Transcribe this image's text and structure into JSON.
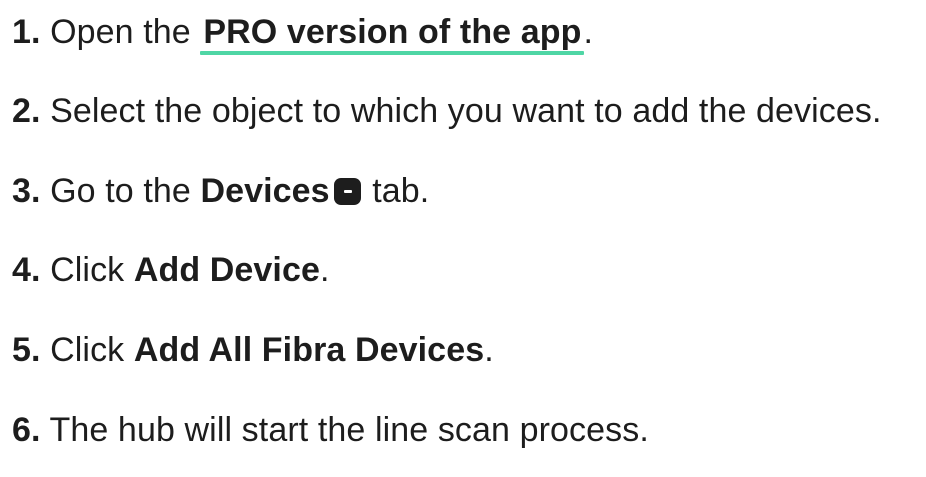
{
  "steps": [
    {
      "number": "1.",
      "before": "Open the",
      "link": "PRO version of the app",
      "after": "."
    },
    {
      "number": "2.",
      "text": "Select the object to which you want to add the devices."
    },
    {
      "number": "3.",
      "before": "Go to the",
      "bold": "Devices",
      "icon": "devices-tab-icon",
      "after": "tab."
    },
    {
      "number": "4.",
      "before": "Click",
      "bold": "Add Device",
      "after": "."
    },
    {
      "number": "5.",
      "before": "Click",
      "bold": "Add All Fibra Devices",
      "after": "."
    },
    {
      "number": "6.",
      "text": "The hub will start the line scan process."
    }
  ],
  "colors": {
    "text": "#1d1d1d",
    "link_underline": "#4fd6a5",
    "background": "#ffffff"
  }
}
